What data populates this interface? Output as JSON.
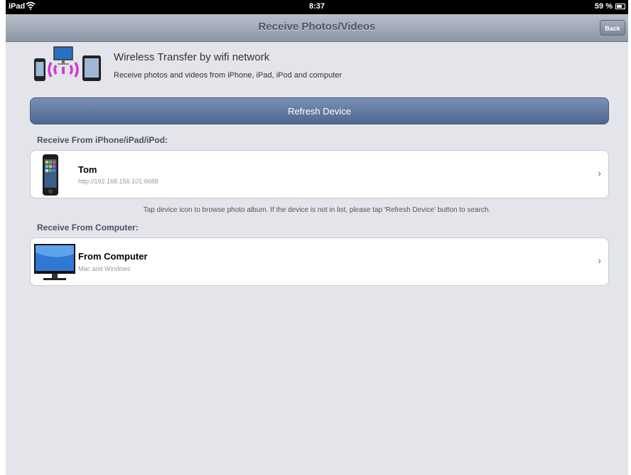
{
  "status_bar": {
    "carrier": "iPad",
    "time": "8:37",
    "battery": "59 %"
  },
  "nav": {
    "title": "Receive Photos/Videos",
    "back_label": "Back"
  },
  "header": {
    "title": "Wireless Transfer by wifi network",
    "subtitle": "Receive photos and videos from iPhone, iPad, iPod and computer"
  },
  "refresh_label": "Refresh Device",
  "sections": {
    "iphone_label": "Receive From iPhone/iPad/iPod:",
    "computer_label": "Receive From Computer:"
  },
  "devices": [
    {
      "name": "Tom",
      "address": "http://192.168.156.101:6688"
    }
  ],
  "hint": "Tap device icon to browse photo album. If the device is not in list, please tap 'Refresh Device' button to search.",
  "computer": {
    "name": "From Computer",
    "sub": "Mac and Windows"
  },
  "icons": {
    "wifi": "wifi-icon",
    "battery": "battery-icon",
    "header": "wireless-transfer-icon",
    "iphone": "iphone-icon",
    "computer": "monitor-icon",
    "chevron": "chevron-right-icon"
  },
  "colors": {
    "accent": "#5a7199",
    "navbar": "#9aa3b2"
  }
}
